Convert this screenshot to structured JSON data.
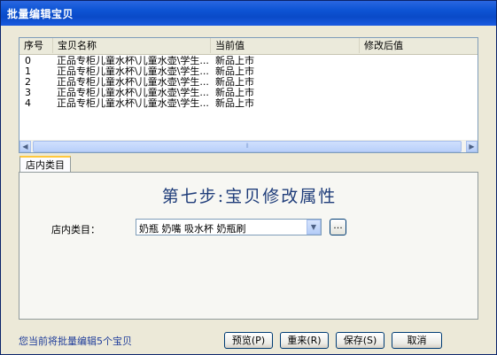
{
  "window": {
    "title": "批量编辑宝贝"
  },
  "list": {
    "columns": [
      "序号",
      "宝贝名称",
      "当前值",
      "修改后值"
    ],
    "rows": [
      {
        "index": "0",
        "name": "正品专柜儿童水杯\\儿童水壶\\学生...",
        "current": "新品上市",
        "new": ""
      },
      {
        "index": "1",
        "name": "正品专柜儿童水杯\\儿童水壶\\学生...",
        "current": "新品上市",
        "new": ""
      },
      {
        "index": "2",
        "name": "正品专柜儿童水杯\\儿童水壶\\学生...",
        "current": "新品上市",
        "new": ""
      },
      {
        "index": "3",
        "name": "正品专柜儿童水杯\\儿童水壶\\学生...",
        "current": "新品上市",
        "new": ""
      },
      {
        "index": "4",
        "name": "正品专柜儿童水杯\\儿童水壶\\学生...",
        "current": "新品上市",
        "new": ""
      }
    ],
    "scroll_left_icon": "◀",
    "scroll_right_icon": "▶",
    "scroll_grip_icon": "⦀"
  },
  "tab": {
    "label": "店内类目"
  },
  "step_title": "第七步:宝贝修改属性",
  "category": {
    "label": "店内类目：",
    "value": "奶瓶 奶嘴 吸水杯 奶瓶刷",
    "dropdown_icon": "▼",
    "browse_label": "..."
  },
  "status": "您当前将批量编辑5个宝贝",
  "buttons": {
    "preview": "预览(P)",
    "reset": "重来(R)",
    "save": "保存(S)",
    "cancel": "取消"
  }
}
